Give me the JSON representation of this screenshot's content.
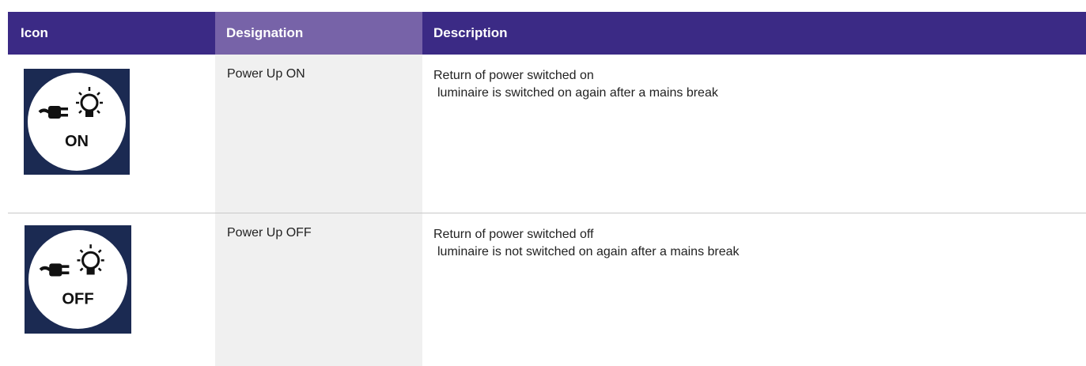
{
  "header": {
    "icon_col": "Icon",
    "designation_col": "Designation",
    "description_col": "Description"
  },
  "rows": [
    {
      "icon": "power-up-on-icon",
      "icon_label": "ON",
      "designation": "Power Up ON",
      "description_main": "Return of power switched on",
      "description_sub": "luminaire is switched on again after a mains break"
    },
    {
      "icon": "power-up-off-icon",
      "icon_label": "OFF",
      "designation": "Power Up OFF",
      "description_main": "Return of power switched off",
      "description_sub": "luminaire is not switched on again after a mains break"
    }
  ],
  "colors": {
    "header_dark": "#3b2a85",
    "header_light": "#7763a8",
    "designation_bg": "#f0f0f0",
    "icon_bg": "#1b2a52"
  }
}
